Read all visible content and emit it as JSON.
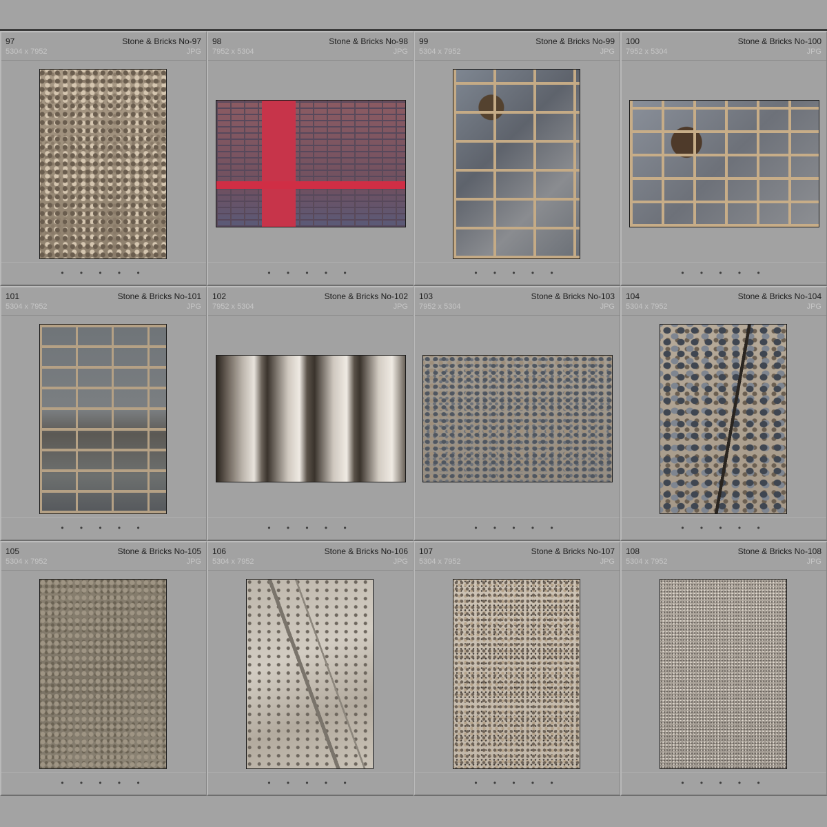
{
  "cells": [
    {
      "index": "97",
      "title": "Stone & Bricks No-97",
      "dims": "5304 x 7952",
      "format": "JPG",
      "dots": "• • • • •"
    },
    {
      "index": "98",
      "title": "Stone & Bricks No-98",
      "dims": "7952 x 5304",
      "format": "JPG",
      "dots": "• • • • •"
    },
    {
      "index": "99",
      "title": "Stone & Bricks No-99",
      "dims": "5304 x 7952",
      "format": "JPG",
      "dots": "• • • • •"
    },
    {
      "index": "100",
      "title": "Stone & Bricks No-100",
      "dims": "7952 x 5304",
      "format": "JPG",
      "dots": "• • • • •"
    },
    {
      "index": "101",
      "title": "Stone & Bricks No-101",
      "dims": "5304 x 7952",
      "format": "JPG",
      "dots": "• • • • •"
    },
    {
      "index": "102",
      "title": "Stone & Bricks No-102",
      "dims": "7952 x 5304",
      "format": "JPG",
      "dots": "• • • • •"
    },
    {
      "index": "103",
      "title": "Stone & Bricks No-103",
      "dims": "7952 x 5304",
      "format": "JPG",
      "dots": "• • • • •"
    },
    {
      "index": "104",
      "title": "Stone & Bricks No-104",
      "dims": "5304 x 7952",
      "format": "JPG",
      "dots": "• • • • •"
    },
    {
      "index": "105",
      "title": "Stone & Bricks No-105",
      "dims": "5304 x 7952",
      "format": "JPG",
      "dots": "• • • • •"
    },
    {
      "index": "106",
      "title": "Stone & Bricks No-106",
      "dims": "5304 x 7952",
      "format": "JPG",
      "dots": "• • • • •"
    },
    {
      "index": "107",
      "title": "Stone & Bricks No-107",
      "dims": "5304 x 7952",
      "format": "JPG",
      "dots": "• • • • •"
    },
    {
      "index": "108",
      "title": "Stone & Bricks No-108",
      "dims": "5304 x 7952",
      "format": "JPG",
      "dots": "• • • • •"
    }
  ]
}
